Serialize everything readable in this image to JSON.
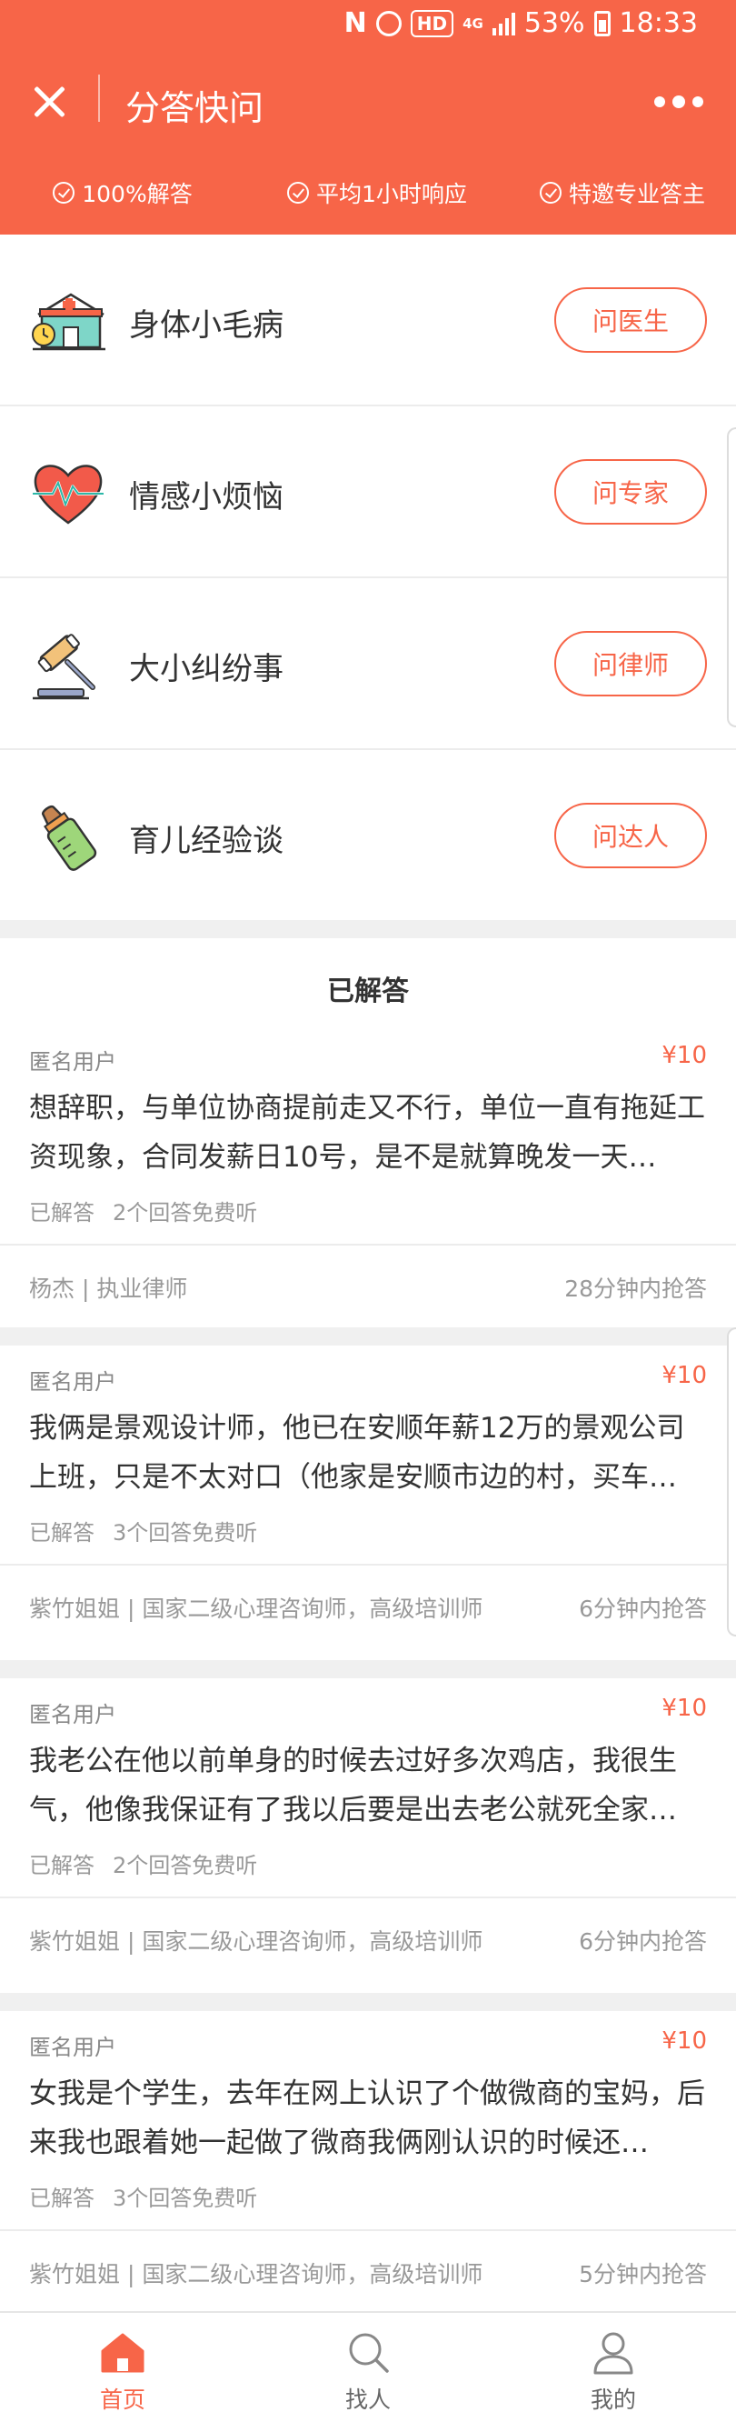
{
  "status_bar": {
    "network": "4G",
    "hd": "HD",
    "battery": "53%",
    "time": "18:33"
  },
  "header": {
    "title": "分答快问",
    "features": [
      "100%解答",
      "平均1小时响应",
      "特邀专业答主"
    ],
    "accent_color": "#f76548"
  },
  "categories": [
    {
      "icon": "clinic-icon",
      "label": "身体小毛病",
      "button": "问医生"
    },
    {
      "icon": "heart-pulse-icon",
      "label": "情感小烦恼",
      "button": "问专家"
    },
    {
      "icon": "gavel-icon",
      "label": "大小纠纷事",
      "button": "问律师"
    },
    {
      "icon": "baby-bottle-icon",
      "label": "育儿经验谈",
      "button": "问达人"
    }
  ],
  "answered": {
    "section_title": "已解答",
    "cards": [
      {
        "user": "匿名用户",
        "price": "¥10",
        "question": "想辞职，与单位协商提前走又不行，单位一直有拖延工资现象，合同发薪日10号，是不是就算晚发一天…",
        "status": "已解答",
        "listen": "2个回答免费听",
        "answerer": "杨杰 | 执业律师",
        "response": "28分钟内抢答"
      },
      {
        "user": "匿名用户",
        "price": "¥10",
        "question": "我俩是景观设计师，他已在安顺年薪12万的景观公司上班，只是不太对口（他家是安顺市边的村，买车…",
        "status": "已解答",
        "listen": "3个回答免费听",
        "answerer": "紫竹姐姐 | 国家二级心理咨询师，高级培训师",
        "response": "6分钟内抢答"
      },
      {
        "user": "匿名用户",
        "price": "¥10",
        "question": "我老公在他以前单身的时候去过好多次鸡店，我很生气，他像我保证有了我以后要是出去老公就死全家…",
        "status": "已解答",
        "listen": "2个回答免费听",
        "answerer": "紫竹姐姐 | 国家二级心理咨询师，高级培训师",
        "response": "6分钟内抢答"
      },
      {
        "user": "匿名用户",
        "price": "¥10",
        "question": "女我是个学生，去年在网上认识了个做微商的宝妈，后来我也跟着她一起做了微商我俩刚认识的时候还…",
        "status": "已解答",
        "listen": "3个回答免费听",
        "answerer": "紫竹姐姐 | 国家二级心理咨询师，高级培训师",
        "response": "5分钟内抢答"
      }
    ]
  },
  "bottom_nav": [
    {
      "icon": "home-icon",
      "label": "首页",
      "active": true
    },
    {
      "icon": "search-icon",
      "label": "找人",
      "active": false
    },
    {
      "icon": "user-icon",
      "label": "我的",
      "active": false
    }
  ]
}
